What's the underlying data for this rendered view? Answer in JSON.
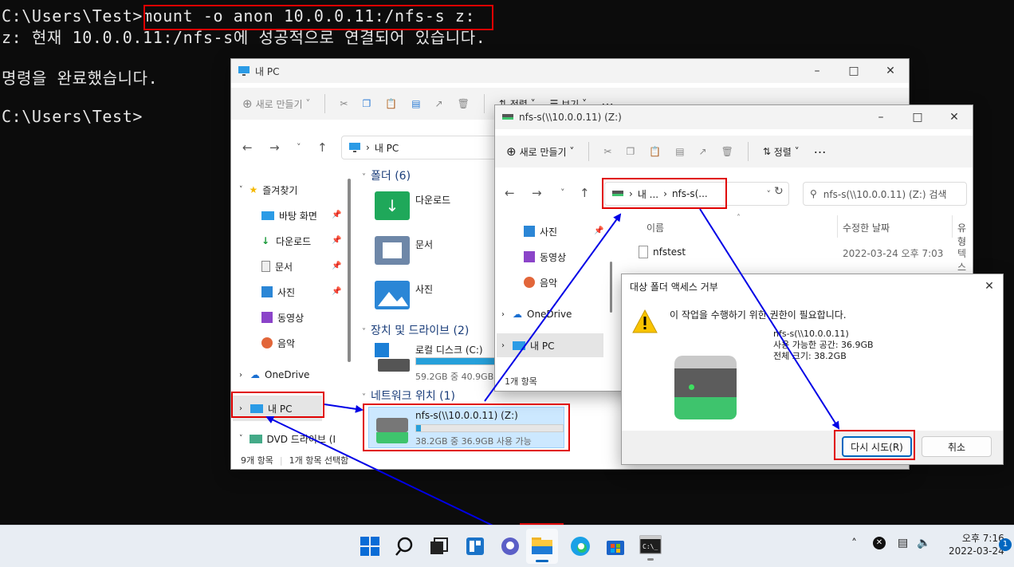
{
  "console": {
    "cmd1_prompt": "C:\\Users\\Test>",
    "cmd1": "mount -o anon 10.0.0.11:/nfs-s z:",
    "result1": "z: 현재 10.0.0.11:/nfs-s에 성공적으로 연결되어 있습니다.",
    "result2": "명령을 완료했습니다.",
    "prompt2": "C:\\Users\\Test>"
  },
  "explorer_pc": {
    "title": "내 PC",
    "toolbar": {
      "new_label": "새로 만들기",
      "sort_label": "정렬",
      "view_label": "보기"
    },
    "address": "내 PC",
    "sidebar": {
      "favorites": "즐겨찾기",
      "items": [
        "바탕 화면",
        "다운로드",
        "문서",
        "사진",
        "동영상",
        "음악"
      ],
      "onedrive": "OneDrive",
      "this_pc": "내 PC",
      "dvd": "DVD 드라이브 (I"
    },
    "groups": {
      "folders": "폴더 (6)",
      "devices": "장치 및 드라이브 (2)",
      "network": "네트워크 위치 (1)"
    },
    "folders": [
      "다운로드",
      "문서",
      "사진"
    ],
    "local_disk": {
      "name": "로컬 디스크 (C:)",
      "info": "59.2GB 중 40.9GB"
    },
    "nfs_drive": {
      "name": "nfs-s(\\\\10.0.0.11) (Z:)",
      "info": "38.2GB 중 36.9GB 사용 가능"
    },
    "status": {
      "count": "9개 항목",
      "selected": "1개 항목 선택함"
    }
  },
  "explorer_nfs": {
    "title": "nfs-s(\\\\10.0.0.11) (Z:)",
    "toolbar": {
      "new_label": "새로 만들기",
      "sort_label": "정렬"
    },
    "address": {
      "part1": "내 ...",
      "part2": "nfs-s(..."
    },
    "search_placeholder": "nfs-s(\\\\10.0.0.11) (Z:) 검색",
    "columns": {
      "name": "이름",
      "modified": "수정한 날짜",
      "type": "유형"
    },
    "file": {
      "name": "nfstest",
      "modified": "2022-03-24 오후 7:03",
      "type": "텍스"
    },
    "sidebar": {
      "items": [
        "사진",
        "동영상",
        "음악"
      ],
      "onedrive": "OneDrive",
      "this_pc": "내 PC"
    },
    "status": {
      "count": "1개 항목"
    }
  },
  "dialog": {
    "title": "대상 폴더 액세스 거부",
    "message": "이 작업을 수행하기 위한 권한이 필요합니다.",
    "drive_name": "nfs-s(\\\\10.0.0.11)",
    "free_space": "사용 가능한 공간: 36.9GB",
    "total_size": "전체 크기: 38.2GB",
    "retry_label": "다시 시도(R)",
    "cancel_label": "취소"
  },
  "taskbar": {
    "time": "오후 7:16",
    "date": "2022-03-24",
    "notification_count": "1"
  },
  "colors": {
    "accent": "#0067c0",
    "highlight": "#e00000",
    "arrow": "#0000e6",
    "drive_bar": "#26a0da"
  }
}
